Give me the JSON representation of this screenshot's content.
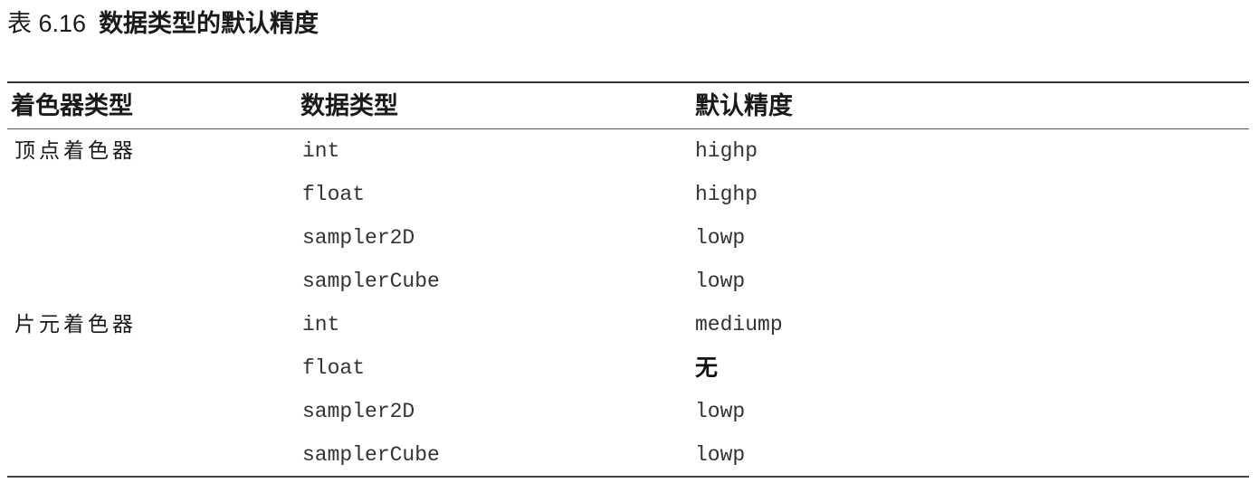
{
  "table": {
    "caption_number": "表 6.16",
    "caption_title": "数据类型的默认精度",
    "headers": [
      "着色器类型",
      "数据类型",
      "默认精度"
    ],
    "rows": [
      {
        "shader": "顶点着色器",
        "type": "int",
        "precision": "highp"
      },
      {
        "shader": "",
        "type": "float",
        "precision": "highp"
      },
      {
        "shader": "",
        "type": "sampler2D",
        "precision": "lowp"
      },
      {
        "shader": "",
        "type": "samplerCube",
        "precision": "lowp"
      },
      {
        "shader": "片元着色器",
        "type": "int",
        "precision": "mediump"
      },
      {
        "shader": "",
        "type": "float",
        "precision": "无"
      },
      {
        "shader": "",
        "type": "sampler2D",
        "precision": "lowp"
      },
      {
        "shader": "",
        "type": "samplerCube",
        "precision": "lowp"
      }
    ]
  }
}
